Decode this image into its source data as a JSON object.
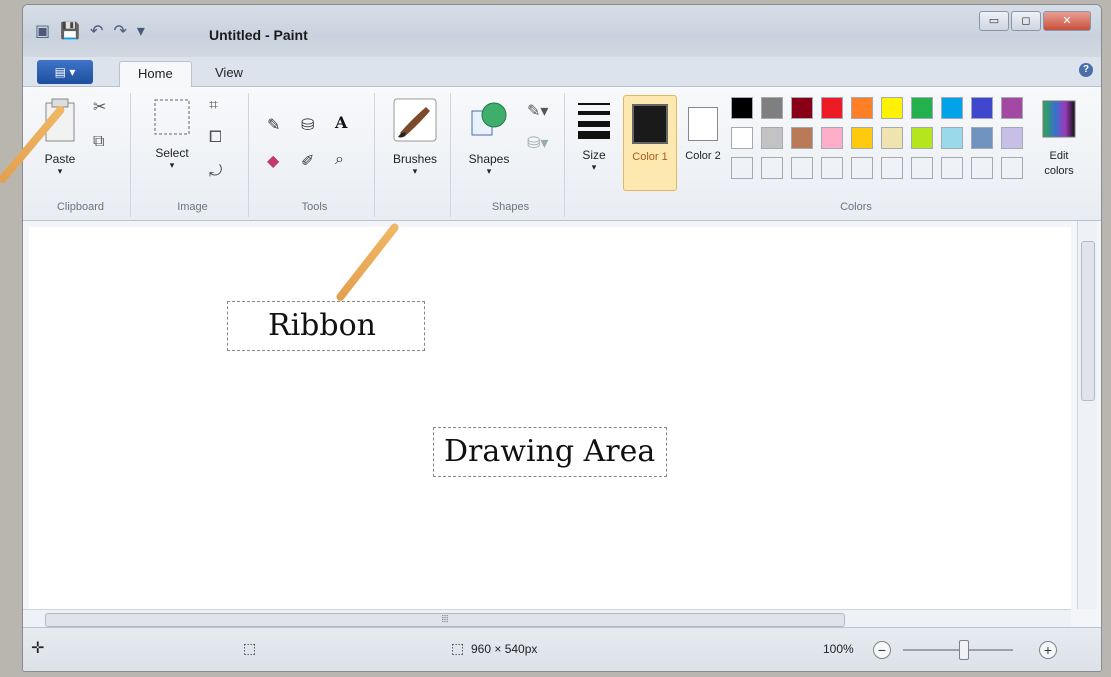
{
  "window": {
    "title": "Untitled - Paint"
  },
  "tabs": {
    "home": "Home",
    "view": "View"
  },
  "groups": {
    "clipboard": {
      "label": "Clipboard",
      "paste": "Paste"
    },
    "image": {
      "label": "Image",
      "select": "Select"
    },
    "tools": {
      "label": "Tools"
    },
    "brushes": {
      "label": "Brushes"
    },
    "shapes": {
      "label": "Shapes",
      "button": "Shapes"
    },
    "size": {
      "label": "Size"
    },
    "colors": {
      "label": "Colors",
      "color1": "Color 1",
      "color2": "Color 2",
      "edit": "Edit colors",
      "palette_row1": [
        "#000000",
        "#7f7f7f",
        "#880015",
        "#ed1c24",
        "#ff7f27",
        "#fff200",
        "#22b14c",
        "#00a2e8",
        "#3f48cc",
        "#a349a4"
      ],
      "palette_row2": [
        "#ffffff",
        "#c3c3c3",
        "#b97a57",
        "#ffaec9",
        "#ffc90e",
        "#efe4b0",
        "#b5e61d",
        "#99d9ea",
        "#7092be",
        "#c8bfe7"
      ]
    }
  },
  "annotations": {
    "ribbon": "Ribbon",
    "drawing_area": "Drawing Area"
  },
  "status": {
    "dimensions": "960 × 540px",
    "zoom": "100%"
  },
  "icons": [
    "save-icon",
    "undo-icon",
    "redo-icon",
    "paste-icon",
    "cut-icon",
    "copy-icon",
    "select-icon",
    "crop-icon",
    "resize-icon",
    "rotate-icon",
    "pencil-icon",
    "fill-icon",
    "text-icon",
    "eraser-icon",
    "color-picker-icon",
    "magnifier-icon",
    "brush-icon",
    "shapes-icon",
    "outline-icon",
    "fill-shape-icon",
    "size-icon",
    "edit-colors-icon",
    "move-icon",
    "selection-size-icon",
    "image-size-icon",
    "zoom-out-icon",
    "zoom-in-icon"
  ]
}
